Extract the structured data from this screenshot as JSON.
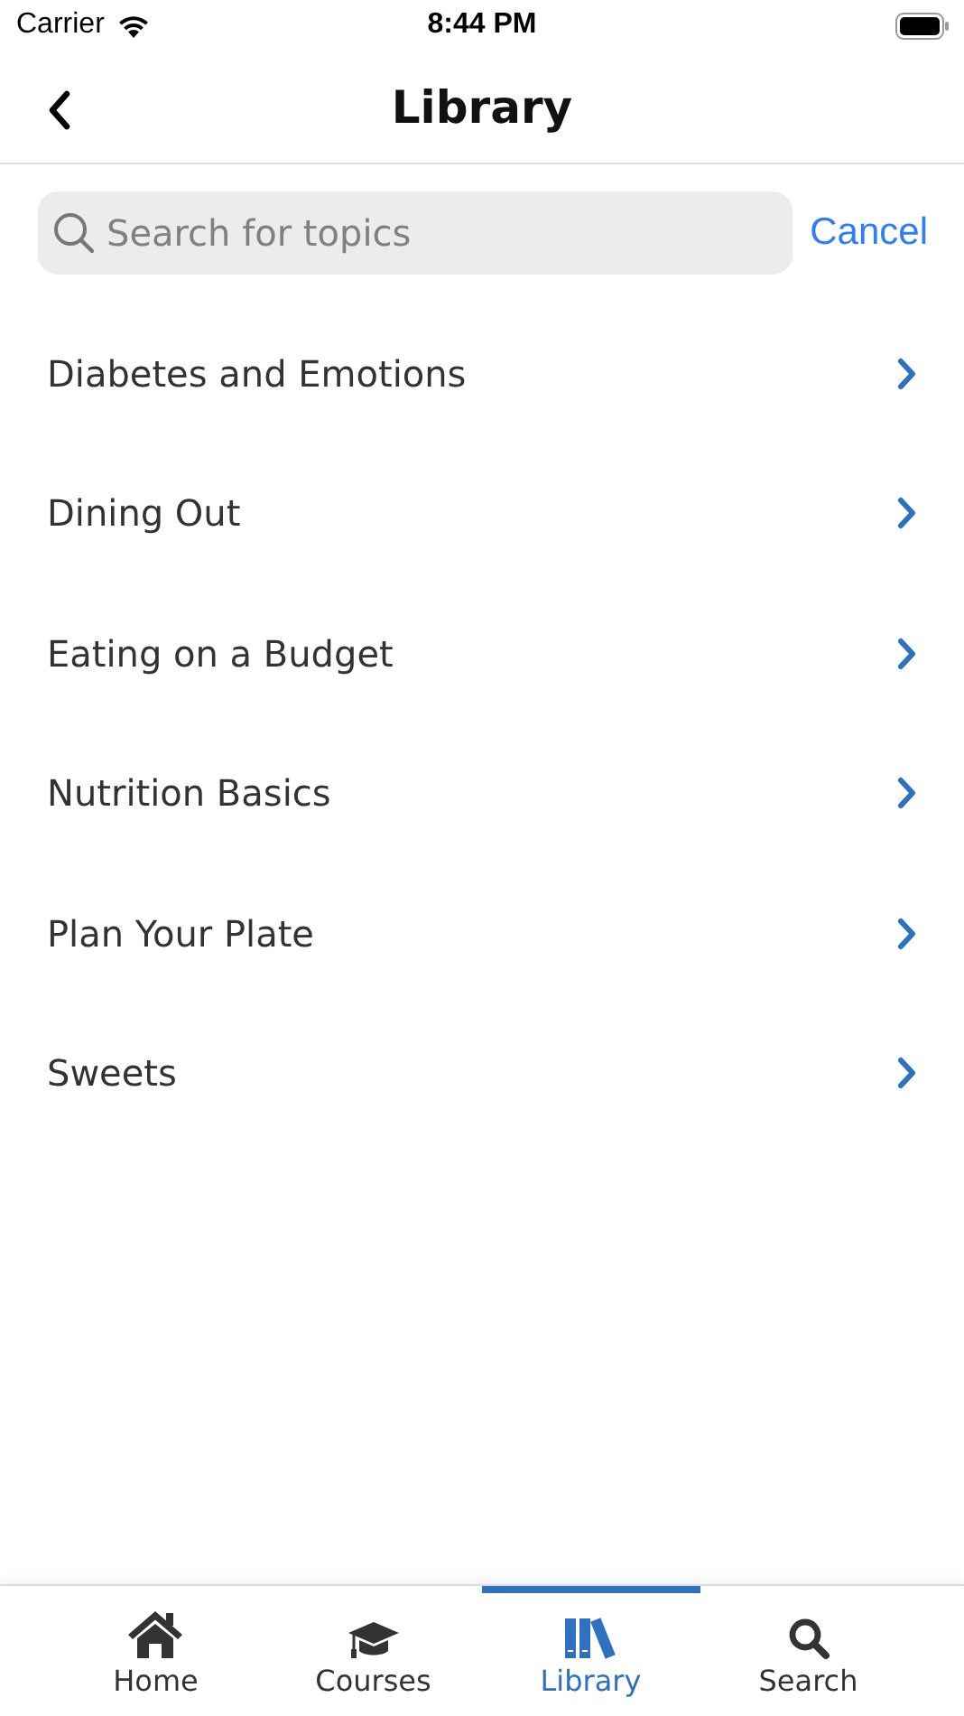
{
  "status_bar": {
    "carrier": "Carrier",
    "time": "8:44 PM"
  },
  "nav": {
    "title": "Library"
  },
  "search": {
    "placeholder": "Search for topics",
    "cancel": "Cancel"
  },
  "topics": [
    {
      "label": "Diabetes and Emotions"
    },
    {
      "label": "Dining Out"
    },
    {
      "label": "Eating on a Budget"
    },
    {
      "label": "Nutrition Basics"
    },
    {
      "label": "Plan Your Plate"
    },
    {
      "label": "Sweets"
    }
  ],
  "tabs": [
    {
      "label": "Home",
      "kind": "home",
      "selected": false
    },
    {
      "label": "Courses",
      "kind": "courses",
      "selected": false
    },
    {
      "label": "Library",
      "kind": "library",
      "selected": true
    },
    {
      "label": "Search",
      "kind": "search",
      "selected": false
    }
  ]
}
